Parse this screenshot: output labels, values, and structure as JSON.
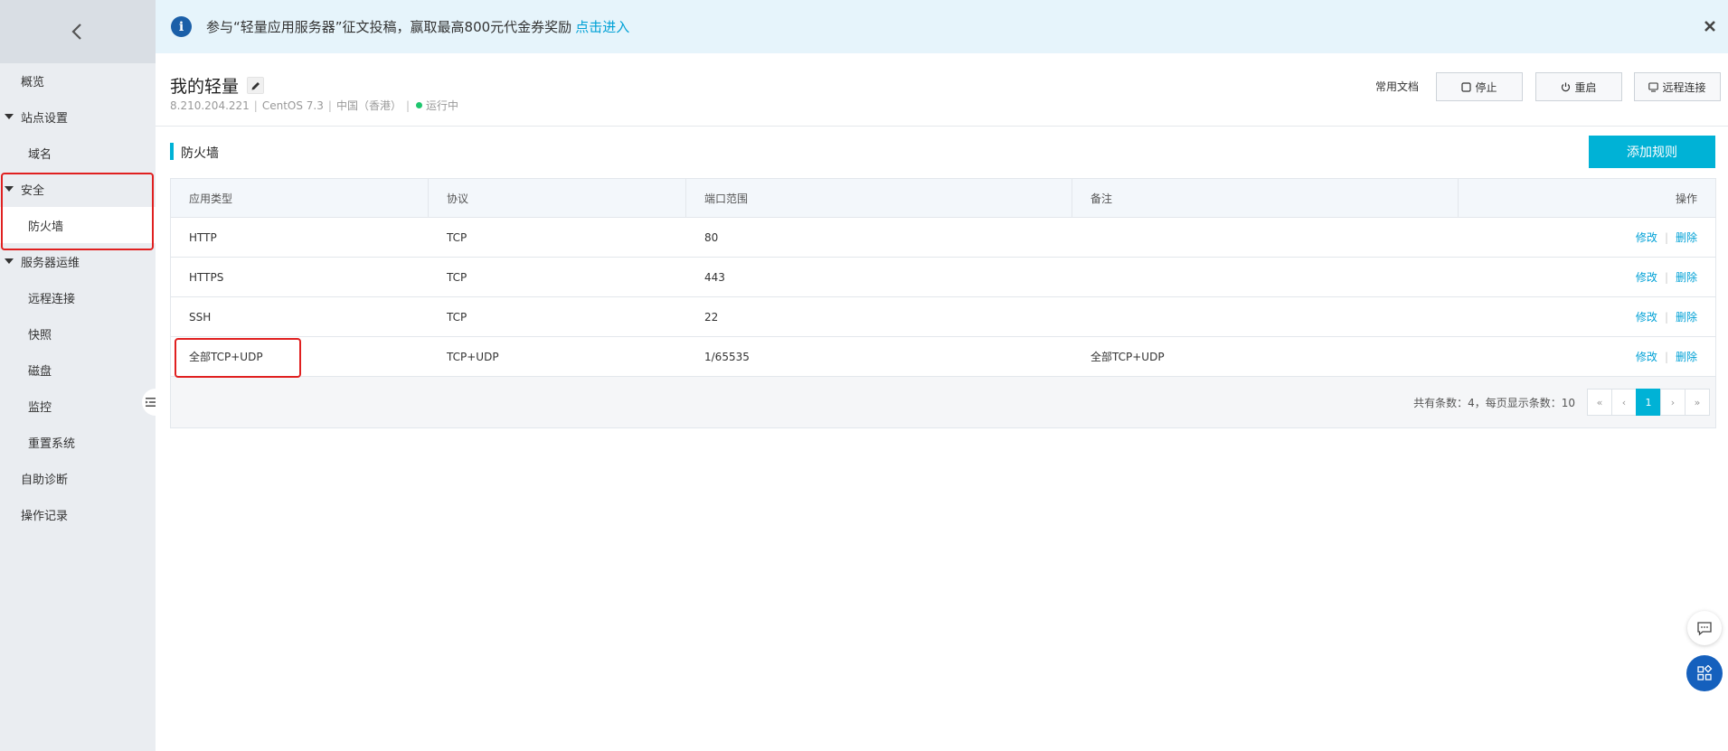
{
  "sidebar": {
    "items": [
      {
        "label": "概览"
      },
      {
        "label": "站点设置"
      },
      {
        "label": "域名"
      },
      {
        "label": "安全"
      },
      {
        "label": "防火墙"
      },
      {
        "label": "服务器运维"
      },
      {
        "label": "远程连接"
      },
      {
        "label": "快照"
      },
      {
        "label": "磁盘"
      },
      {
        "label": "监控"
      },
      {
        "label": "重置系统"
      },
      {
        "label": "自助诊断"
      },
      {
        "label": "操作记录"
      }
    ]
  },
  "notice": {
    "text": "参与“轻量应用服务器”征文投稿，赢取最高800元代金券奖励",
    "link": "点击进入"
  },
  "header": {
    "title": "我的轻量",
    "ip": "8.210.204.221",
    "os": "CentOS  7.3",
    "region": "中国（香港）",
    "status": "运行中",
    "docs_label": "常用文档",
    "stop_label": "停止",
    "restart_label": "重启",
    "remote_label": "远程连接"
  },
  "section": {
    "title": "防火墙",
    "add_label": "添加规则"
  },
  "table": {
    "headers": [
      "应用类型",
      "协议",
      "端口范围",
      "备注",
      "操作"
    ],
    "rows": [
      {
        "type": "HTTP",
        "protocol": "TCP",
        "port": "80",
        "note": ""
      },
      {
        "type": "HTTPS",
        "protocol": "TCP",
        "port": "443",
        "note": ""
      },
      {
        "type": "SSH",
        "protocol": "TCP",
        "port": "22",
        "note": ""
      },
      {
        "type": "全部TCP+UDP",
        "protocol": "TCP+UDP",
        "port": "1/65535",
        "note": "全部TCP+UDP"
      }
    ],
    "op_edit": "修改",
    "op_sep": "|",
    "op_delete": "删除"
  },
  "pagination": {
    "summary": "共有条数：4，每页显示条数：10",
    "first": "«",
    "prev": "‹",
    "current": "1",
    "next": "›",
    "last": "»"
  },
  "colors": {
    "accent": "#00b2d6",
    "highlight_border": "#e02020",
    "status_running": "#1ec66e"
  }
}
